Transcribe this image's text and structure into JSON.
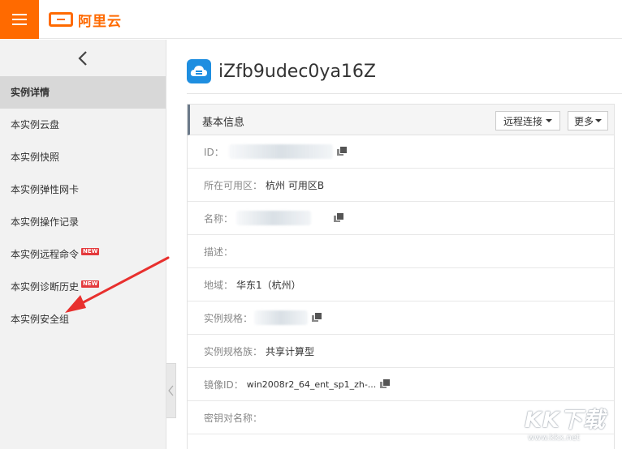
{
  "brand": {
    "name": "阿里云",
    "accent": "#ff6a00"
  },
  "sidebar": {
    "items": [
      {
        "label": "实例详情",
        "active": true
      },
      {
        "label": "本实例云盘"
      },
      {
        "label": "本实例快照"
      },
      {
        "label": "本实例弹性网卡"
      },
      {
        "label": "本实例操作记录"
      },
      {
        "label": "本实例远程命令",
        "badge": "NEW"
      },
      {
        "label": "本实例诊断历史",
        "badge": "NEW"
      },
      {
        "label": "本实例安全组"
      }
    ]
  },
  "instance": {
    "title": "iZfb9udec0ya16Z"
  },
  "panel": {
    "title": "基本信息",
    "remote_button": "远程连接",
    "more_button": "更多",
    "rows": [
      {
        "label": "ID：",
        "value": ""
      },
      {
        "label": "所在可用区：",
        "value": "杭州 可用区B"
      },
      {
        "label": "名称：",
        "value": ""
      },
      {
        "label": "描述：",
        "value": ""
      },
      {
        "label": "地域：",
        "value": "华东1（杭州）"
      },
      {
        "label": "实例规格：",
        "value": ""
      },
      {
        "label": "实例规格族：",
        "value": "共享计算型"
      },
      {
        "label": "镜像ID：",
        "value": "win2008r2_64_ent_sp1_zh-..."
      },
      {
        "label": "密钥对名称：",
        "value": ""
      }
    ]
  },
  "watermark": {
    "main": "KK下载",
    "sub": "www.kkx.net"
  }
}
